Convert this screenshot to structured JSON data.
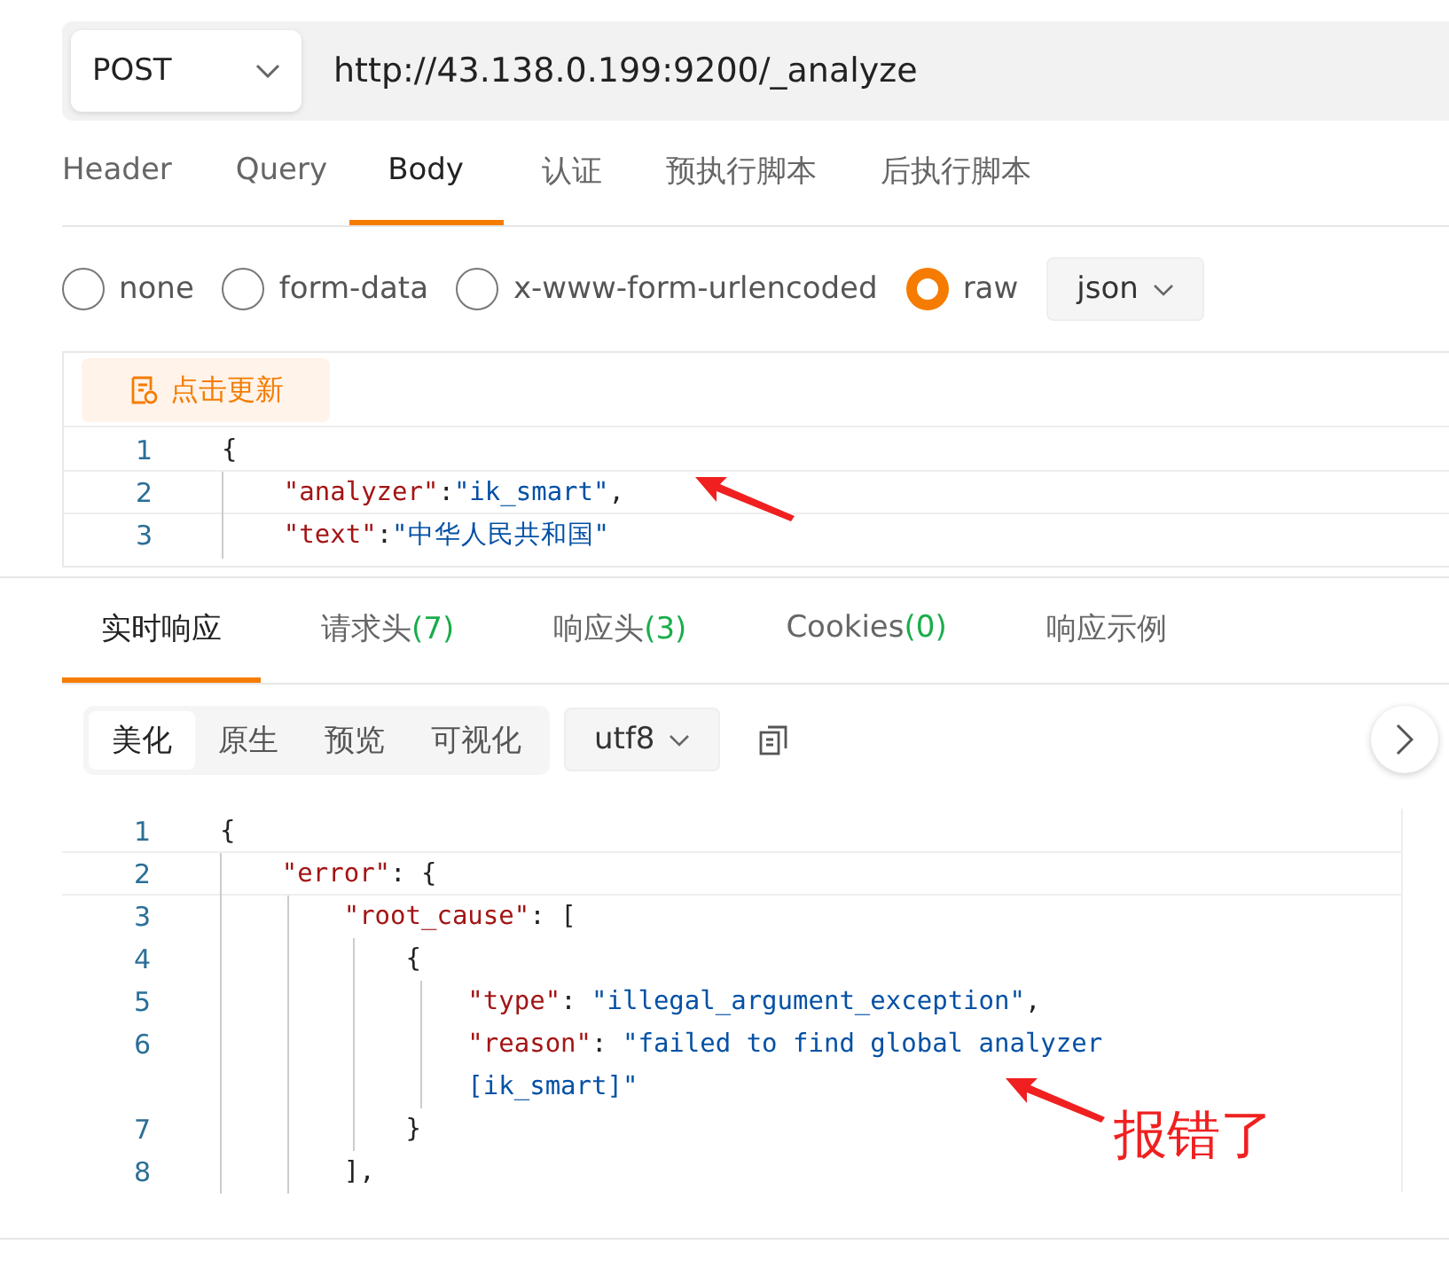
{
  "request": {
    "method": "POST",
    "url": "http://43.138.0.199:9200/_analyze"
  },
  "request_tabs": [
    {
      "label": "Header",
      "selected": false
    },
    {
      "label": "Query",
      "selected": false
    },
    {
      "label": "Body",
      "selected": true
    },
    {
      "label": "认证",
      "selected": false
    },
    {
      "label": "预执行脚本",
      "selected": false
    },
    {
      "label": "后执行脚本",
      "selected": false
    }
  ],
  "body_types": [
    {
      "label": "none",
      "selected": false
    },
    {
      "label": "form-data",
      "selected": false
    },
    {
      "label": "x-www-form-urlencoded",
      "selected": false
    },
    {
      "label": "raw",
      "selected": true
    }
  ],
  "format": "json",
  "update_button": "点击更新",
  "body_lines": [
    {
      "number": "1",
      "tokens": [
        {
          "kind": "punct",
          "text": "{"
        }
      ]
    },
    {
      "number": "2",
      "tokens": [
        {
          "kind": "key",
          "text": "    \"analyzer\""
        },
        {
          "kind": "punct",
          "text": ":"
        },
        {
          "kind": "string",
          "text": "\"ik_smart\""
        },
        {
          "kind": "punct",
          "text": ","
        }
      ],
      "annotated": true
    },
    {
      "number": "3",
      "tokens": [
        {
          "kind": "key",
          "text": "    \"text\""
        },
        {
          "kind": "punct",
          "text": ":"
        },
        {
          "kind": "string",
          "text": "\"中华人民共和国\""
        }
      ]
    }
  ],
  "response_tabs": [
    {
      "label": "实时响应",
      "selected": true
    },
    {
      "label": "请求头",
      "count": "(7)",
      "selected": false
    },
    {
      "label": "响应头",
      "count": "(3)",
      "selected": false
    },
    {
      "label": "Cookies",
      "count": "(0)",
      "selected": false
    },
    {
      "label": "响应示例",
      "selected": false
    }
  ],
  "view_modes": [
    {
      "label": "美化",
      "selected": true
    },
    {
      "label": "原生",
      "selected": false
    },
    {
      "label": "预览",
      "selected": false
    },
    {
      "label": "可视化",
      "selected": false
    }
  ],
  "encoding": "utf8",
  "response_lines": [
    {
      "number": "1",
      "tokens": [
        {
          "kind": "punct",
          "text": "{"
        }
      ]
    },
    {
      "number": "2",
      "tokens": [
        {
          "kind": "key",
          "text": "    \"error\""
        },
        {
          "kind": "punct",
          "text": ": {"
        }
      ]
    },
    {
      "number": "3",
      "tokens": [
        {
          "kind": "key",
          "text": "        \"root_cause\""
        },
        {
          "kind": "punct",
          "text": ": ["
        }
      ]
    },
    {
      "number": "4",
      "tokens": [
        {
          "kind": "punct",
          "text": "            {"
        }
      ]
    },
    {
      "number": "5",
      "tokens": [
        {
          "kind": "key",
          "text": "                \"type\""
        },
        {
          "kind": "punct",
          "text": ": "
        },
        {
          "kind": "string",
          "text": "\"illegal_argument_exception\""
        },
        {
          "kind": "punct",
          "text": ","
        }
      ]
    },
    {
      "number": "6",
      "tokens": [
        {
          "kind": "key",
          "text": "                \"reason\""
        },
        {
          "kind": "punct",
          "text": ": "
        },
        {
          "kind": "string",
          "text": "\"failed to find global analyzer"
        }
      ]
    },
    {
      "tokens": [
        {
          "kind": "string",
          "text": "                [ik_smart]\""
        }
      ],
      "annotated": true
    },
    {
      "number": "7",
      "tokens": [
        {
          "kind": "punct",
          "text": "            }"
        }
      ]
    },
    {
      "number": "8",
      "tokens": [
        {
          "kind": "punct",
          "text": "        ],"
        }
      ]
    }
  ],
  "annotation": "报错了"
}
